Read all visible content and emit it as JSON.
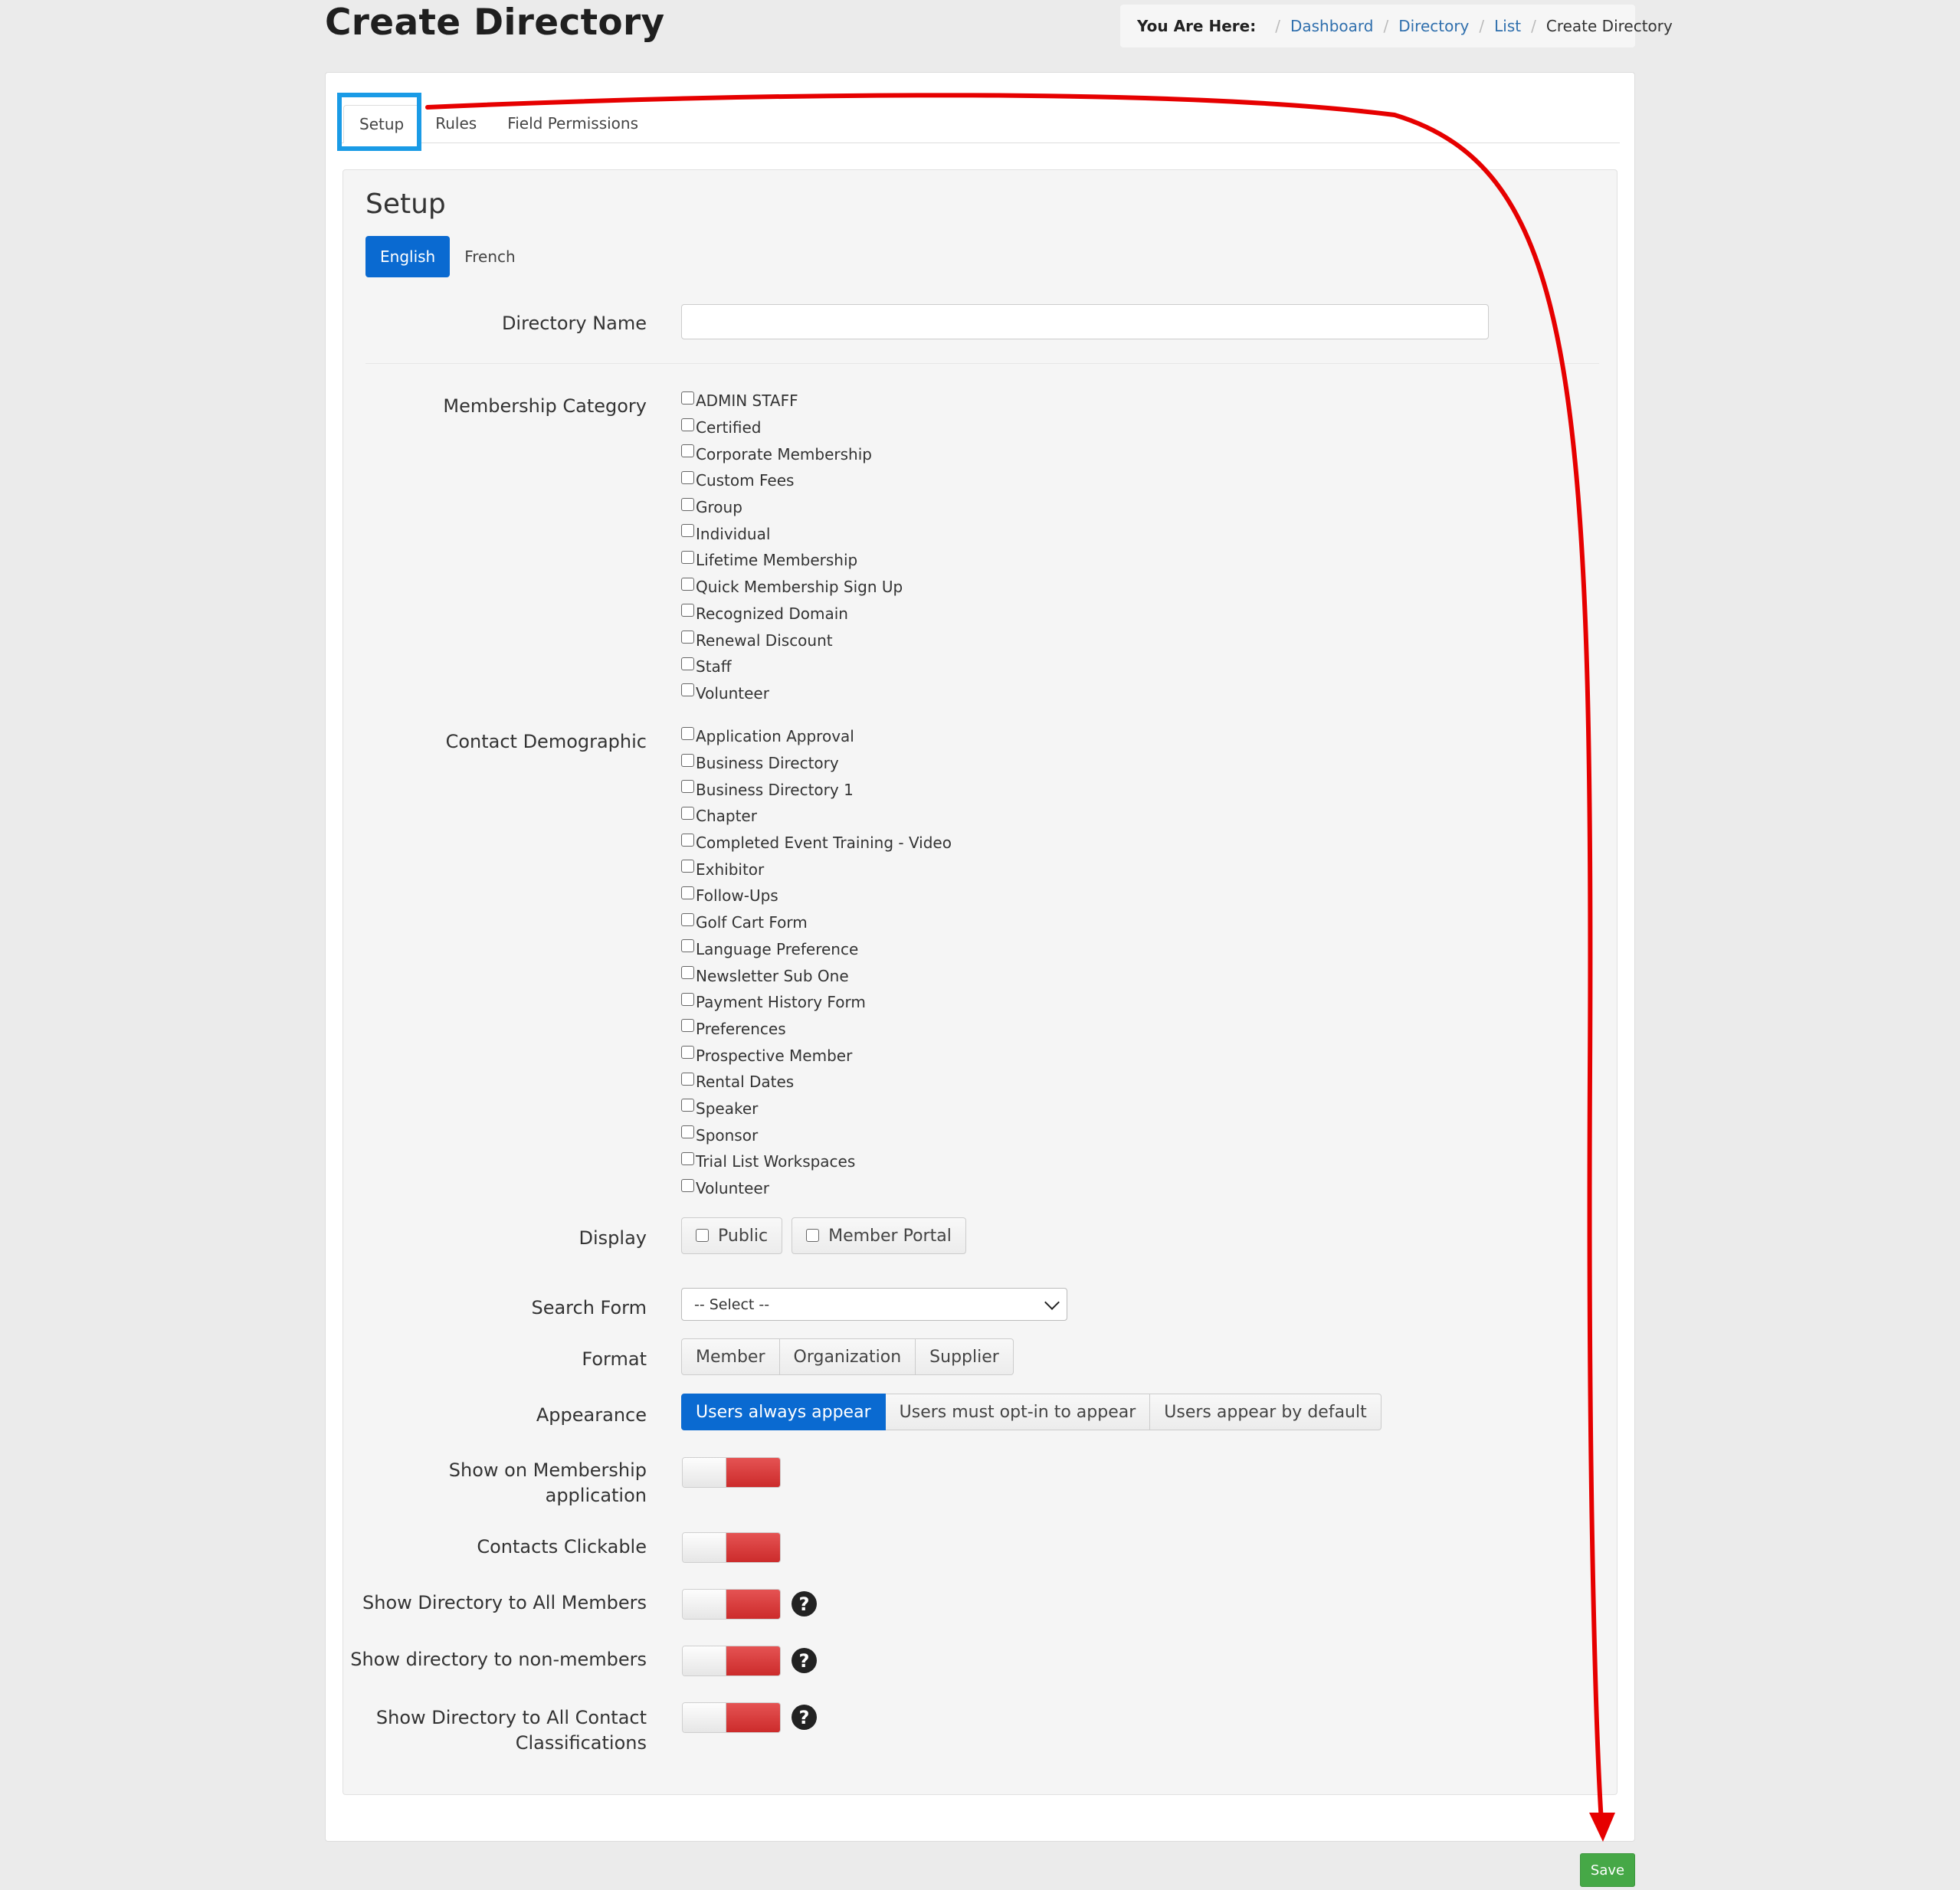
{
  "page": {
    "title": "Create Directory"
  },
  "breadcrumb": {
    "lead": "You Are Here:",
    "items": [
      "Dashboard",
      "Directory",
      "List"
    ],
    "current": "Create Directory",
    "separator": "/"
  },
  "tabs": [
    {
      "label": "Setup",
      "active": true
    },
    {
      "label": "Rules",
      "active": false
    },
    {
      "label": "Field Permissions",
      "active": false
    }
  ],
  "setup": {
    "title": "Setup",
    "languages": [
      {
        "label": "English",
        "active": true
      },
      {
        "label": "French",
        "active": false
      }
    ],
    "directory_name": {
      "label": "Directory Name",
      "value": "",
      "placeholder": ""
    },
    "membership_category": {
      "label": "Membership Category",
      "options": [
        "ADMIN STAFF",
        "Certified",
        "Corporate Membership",
        "Custom Fees",
        "Group",
        "Individual",
        "Lifetime Membership",
        "Quick Membership Sign Up",
        "Recognized Domain",
        "Renewal Discount",
        "Staff",
        "Volunteer"
      ]
    },
    "contact_demographic": {
      "label": "Contact Demographic",
      "options": [
        "Application Approval",
        "Business Directory",
        "Business Directory 1",
        "Chapter",
        "Completed Event Training - Video",
        "Exhibitor",
        "Follow-Ups",
        "Golf Cart Form",
        "Language Preference",
        "Newsletter Sub One",
        "Payment History Form",
        "Preferences",
        "Prospective Member",
        "Rental Dates",
        "Speaker",
        "Sponsor",
        "Trial List Workspaces",
        "Volunteer"
      ]
    },
    "display": {
      "label": "Display",
      "options": [
        "Public",
        "Member Portal"
      ]
    },
    "search_form": {
      "label": "Search Form",
      "selected": "-- Select --"
    },
    "format": {
      "label": "Format",
      "options": [
        "Member",
        "Organization",
        "Supplier"
      ]
    },
    "appearance": {
      "label": "Appearance",
      "options": [
        "Users always appear",
        "Users must opt-in to appear",
        "Users appear by default"
      ],
      "selected": "Users always appear"
    },
    "toggles": {
      "show_on_membership_line1": "Show on Membership",
      "show_on_membership_line2": "application",
      "contacts_clickable": "Contacts Clickable",
      "show_all_members": "Show Directory to All Members",
      "show_non_members": "Show directory to non-members",
      "show_all_classifications_line1": "Show Directory to All Contact",
      "show_all_classifications_line2": "Classifications"
    },
    "help_glyph": "?"
  },
  "save_label": "Save",
  "colors": {
    "primary": "#0a6ad1",
    "toggle_off": "#d63a3a",
    "save": "#46a847",
    "highlight": "#1a9be6",
    "annotation_arrow": "#e60000"
  },
  "icons": {
    "help": "help-circle-icon",
    "dropdown": "chevron-down-icon"
  }
}
